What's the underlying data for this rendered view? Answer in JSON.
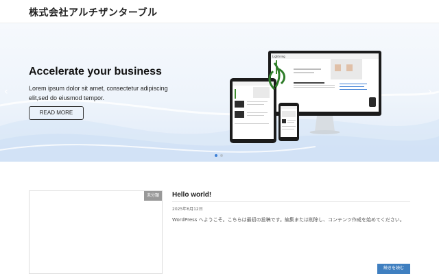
{
  "site": {
    "title": "株式会社アルチザンターブル"
  },
  "hero": {
    "heading": "Accelerate your business",
    "subtext": "Lorem ipsum dolor sit amet, consectetur adipiscing elit,sed do eiusmod tempor.",
    "cta_label": "READ MORE",
    "prev_arrow": "‹",
    "next_arrow": "›",
    "slides": 2,
    "active_slide": 1,
    "devices_icon": "responsive-devices-illustration",
    "device_brand": "Lightning"
  },
  "post": {
    "category_badge": "未分類",
    "title": "Hello world!",
    "date": "2025年6月12日",
    "excerpt": "WordPress へようこそ。こちらは最初の投稿です。編集または削除し、コンテンツ作成を始めてください。",
    "continue_label": "続きを読む"
  },
  "colors": {
    "accent": "#3f7fc0",
    "active_dot": "#3d7fd6",
    "badge_bg": "#999999"
  }
}
